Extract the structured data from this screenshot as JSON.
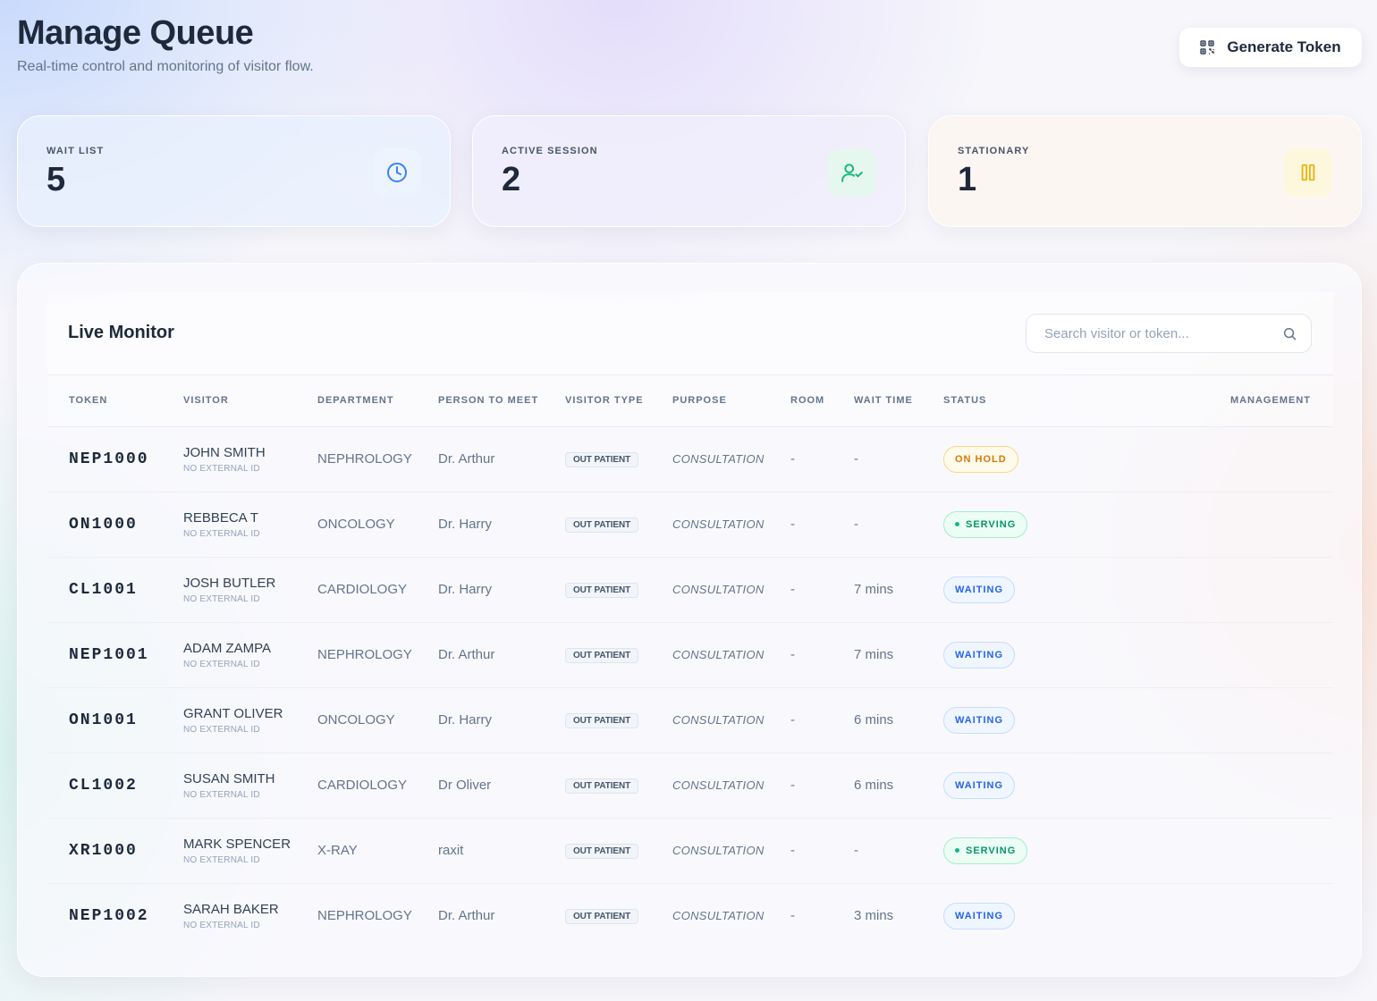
{
  "header": {
    "title": "Manage Queue",
    "subtitle": "Real-time control and monitoring of visitor flow.",
    "generate_label": "Generate Token"
  },
  "stats": [
    {
      "label": "WAIT LIST",
      "value": "5",
      "icon": "clock-icon",
      "color": "#3b82f6"
    },
    {
      "label": "ACTIVE SESSION",
      "value": "2",
      "icon": "user-check-icon",
      "color": "#10b981"
    },
    {
      "label": "STATIONARY",
      "value": "1",
      "icon": "pause-icon",
      "color": "#eab308"
    }
  ],
  "monitor": {
    "title": "Live Monitor",
    "search_placeholder": "Search visitor or token...",
    "columns": [
      "TOKEN",
      "VISITOR",
      "DEPARTMENT",
      "PERSON TO MEET",
      "VISITOR TYPE",
      "PURPOSE",
      "ROOM",
      "WAIT TIME",
      "STATUS",
      "MANAGEMENT"
    ],
    "rows": [
      {
        "token": "NEP1000",
        "name": "JOHN SMITH",
        "ext": "NO EXTERNAL ID",
        "dept": "NEPHROLOGY",
        "person": "Dr. Arthur",
        "type": "OUT PATIENT",
        "purpose": "CONSULTATION",
        "room": "-",
        "wait": "-",
        "status": "ON HOLD",
        "status_kind": "onhold"
      },
      {
        "token": "ON1000",
        "name": "REBBECA T",
        "ext": "NO EXTERNAL ID",
        "dept": "ONCOLOGY",
        "person": "Dr. Harry",
        "type": "OUT PATIENT",
        "purpose": "CONSULTATION",
        "room": "-",
        "wait": "-",
        "status": "SERVING",
        "status_kind": "serving"
      },
      {
        "token": "CL1001",
        "name": "JOSH BUTLER",
        "ext": "NO EXTERNAL ID",
        "dept": "CARDIOLOGY",
        "person": "Dr. Harry",
        "type": "OUT PATIENT",
        "purpose": "CONSULTATION",
        "room": "-",
        "wait": "7 mins",
        "status": "WAITING",
        "status_kind": "waiting"
      },
      {
        "token": "NEP1001",
        "name": "ADAM ZAMPA",
        "ext": "NO EXTERNAL ID",
        "dept": "NEPHROLOGY",
        "person": "Dr. Arthur",
        "type": "OUT PATIENT",
        "purpose": "CONSULTATION",
        "room": "-",
        "wait": "7 mins",
        "status": "WAITING",
        "status_kind": "waiting"
      },
      {
        "token": "ON1001",
        "name": "GRANT OLIVER",
        "ext": "NO EXTERNAL ID",
        "dept": "ONCOLOGY",
        "person": "Dr. Harry",
        "type": "OUT PATIENT",
        "purpose": "CONSULTATION",
        "room": "-",
        "wait": "6 mins",
        "status": "WAITING",
        "status_kind": "waiting"
      },
      {
        "token": "CL1002",
        "name": "SUSAN SMITH",
        "ext": "NO EXTERNAL ID",
        "dept": "CARDIOLOGY",
        "person": "Dr Oliver",
        "type": "OUT PATIENT",
        "purpose": "CONSULTATION",
        "room": "-",
        "wait": "6 mins",
        "status": "WAITING",
        "status_kind": "waiting"
      },
      {
        "token": "XR1000",
        "name": "MARK SPENCER",
        "ext": "NO EXTERNAL ID",
        "dept": "X-RAY",
        "person": "raxit",
        "type": "OUT PATIENT",
        "purpose": "CONSULTATION",
        "room": "-",
        "wait": "-",
        "status": "SERVING",
        "status_kind": "serving"
      },
      {
        "token": "NEP1002",
        "name": "SARAH BAKER",
        "ext": "NO EXTERNAL ID",
        "dept": "NEPHROLOGY",
        "person": "Dr. Arthur",
        "type": "OUT PATIENT",
        "purpose": "CONSULTATION",
        "room": "-",
        "wait": "3 mins",
        "status": "WAITING",
        "status_kind": "waiting"
      }
    ]
  }
}
